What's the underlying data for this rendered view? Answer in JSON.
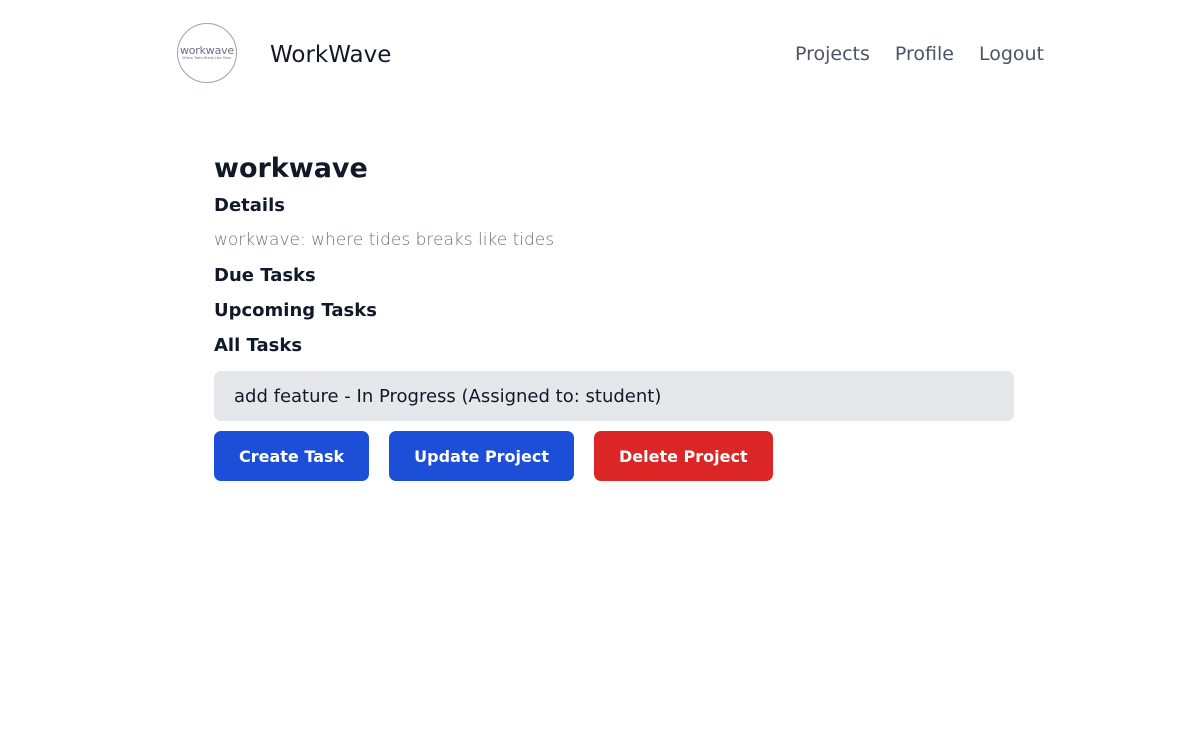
{
  "header": {
    "logo": {
      "word": "workwave",
      "tagline": "Where Tasks Break Like Tides"
    },
    "brand": "WorkWave",
    "nav": [
      {
        "label": "Projects"
      },
      {
        "label": "Profile"
      },
      {
        "label": "Logout"
      }
    ]
  },
  "project": {
    "name": "workwave",
    "details_label": "Details",
    "description": "workwave: where tides breaks like tides",
    "due_tasks_label": "Due Tasks",
    "upcoming_tasks_label": "Upcoming Tasks",
    "all_tasks_label": "All Tasks",
    "tasks": [
      {
        "text": "add feature - In Progress (Assigned to: student)"
      }
    ]
  },
  "actions": {
    "create_task": "Create Task",
    "update_project": "Update Project",
    "delete_project": "Delete Project"
  },
  "colors": {
    "primary": "#1d4ed8",
    "danger": "#dc2626",
    "task_bg": "#e5e7eb",
    "muted_text": "#6b7280"
  }
}
